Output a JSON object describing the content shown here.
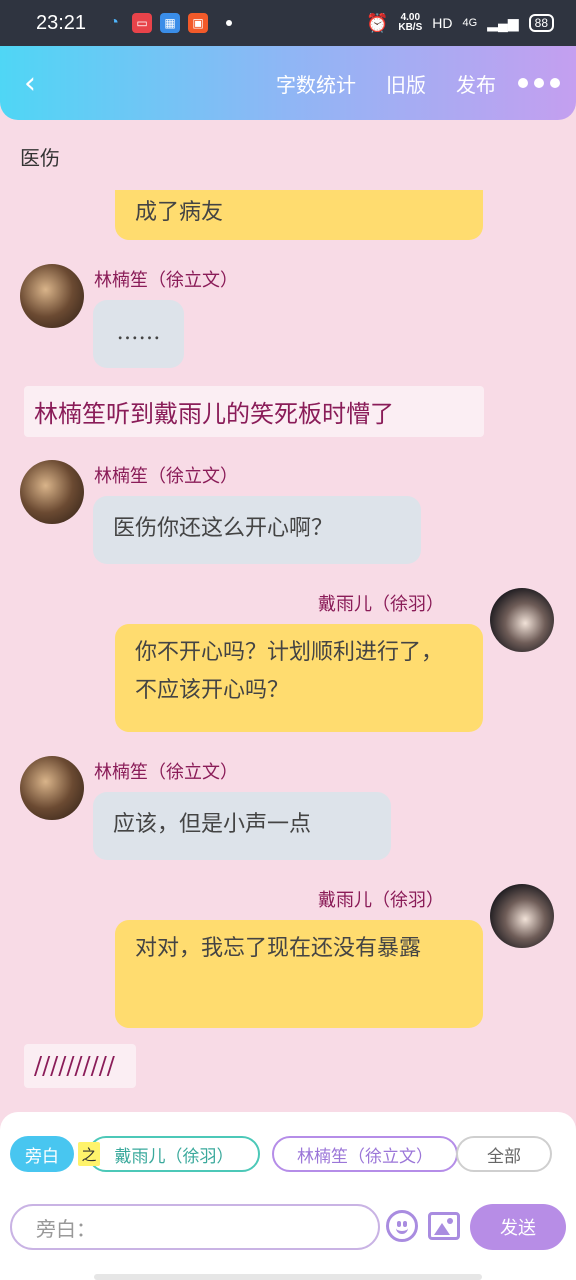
{
  "status_bar": {
    "time": "23:21",
    "speed_value": "4.00",
    "speed_unit": "KB/S",
    "hd": "HD",
    "network": "4G",
    "battery": "88",
    "icons": [
      "qq-icon",
      "video-icon",
      "app-icon",
      "app2-icon",
      "alarm-icon",
      "signal-icon"
    ]
  },
  "header": {
    "back_icon": "back-arrow-icon",
    "links": [
      "字数统计",
      "旧版",
      "发布"
    ],
    "more_icon": "more-dots-icon",
    "gradient_start": "#4fd6f5",
    "gradient_end": "#c49ff0"
  },
  "chat": {
    "scene_label": "医伤",
    "messages": [
      {
        "type": "bubble-right",
        "text": "成了病友"
      },
      {
        "type": "left",
        "name": "林楠笙（徐立文）",
        "text": "……"
      },
      {
        "type": "narration",
        "text": "林楠笙听到戴雨儿的笑死板时懵了"
      },
      {
        "type": "left",
        "name": "林楠笙（徐立文）",
        "text": "医伤你还这么开心啊？"
      },
      {
        "type": "right",
        "name": "戴雨儿（徐羽）",
        "text": "你不开心吗？计划顺利进行了，不应该开心吗？"
      },
      {
        "type": "left",
        "name": "林楠笙（徐立文）",
        "text": "应该，但是小声一点"
      },
      {
        "type": "right",
        "name": "戴雨儿（徐羽）",
        "text": "对对，我忘了现在还没有暴露"
      },
      {
        "type": "narration",
        "text": "//////////"
      }
    ]
  },
  "composer": {
    "chip_aside": "旁白",
    "chip_of": "之",
    "chip_dai": "戴雨儿（徐羽）",
    "chip_lin": "林楠笙（徐立文）",
    "chip_all": "全部",
    "input_placeholder": "旁白：",
    "send_label": "发送",
    "emoji_icon": "emoji-icon",
    "image_icon": "image-icon",
    "accent": "#b78de6"
  }
}
